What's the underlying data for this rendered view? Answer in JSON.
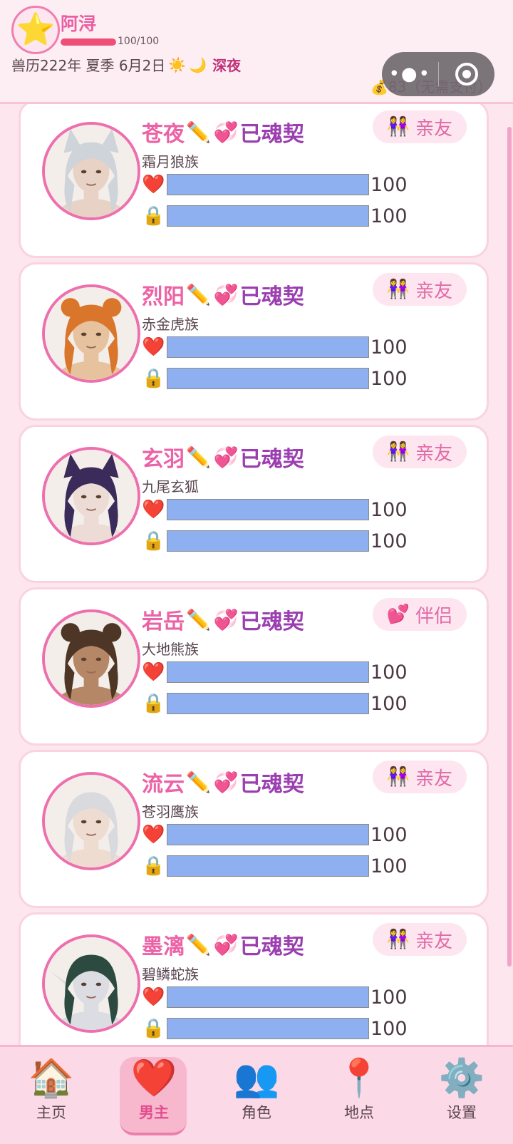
{
  "player": {
    "avatar_icon": "⭐",
    "name": "阿浔",
    "hp_current": 100,
    "hp_max": 100,
    "hp_text": "100/100",
    "date": "兽历222年 夏季 6月2日",
    "weather_icon": "☀️",
    "moon_icon": "🌙",
    "time_of_day": "深夜",
    "coins_text": "💰83（无需支付）"
  },
  "capsule": {
    "more_label": "•●•"
  },
  "characters": [
    {
      "name": "苍夜",
      "edit_icon": "✏️",
      "bond_icon": "💞",
      "status": "已魂契",
      "race": "霜月狼族",
      "tag_icon": "👭",
      "tag": "亲友",
      "affection": 100,
      "trust": 100,
      "affection_text": "100",
      "trust_text": "100",
      "hair": "#cfd3da",
      "skin": "#e8d2c6",
      "ears": "wolf"
    },
    {
      "name": "烈阳",
      "edit_icon": "✏️",
      "bond_icon": "💞",
      "status": "已魂契",
      "race": "赤金虎族",
      "tag_icon": "👭",
      "tag": "亲友",
      "affection": 100,
      "trust": 100,
      "affection_text": "100",
      "trust_text": "100",
      "hair": "#d9762b",
      "skin": "#e6c29e",
      "ears": "tiger"
    },
    {
      "name": "玄羽",
      "edit_icon": "✏️",
      "bond_icon": "💞",
      "status": "已魂契",
      "race": "九尾玄狐",
      "tag_icon": "👭",
      "tag": "亲友",
      "affection": 100,
      "trust": 100,
      "affection_text": "100",
      "trust_text": "100",
      "hair": "#3b2b5a",
      "skin": "#eddcd6",
      "ears": "fox"
    },
    {
      "name": "岩岳",
      "edit_icon": "✏️",
      "bond_icon": "💞",
      "status": "已魂契",
      "race": "大地熊族",
      "tag_icon": "💕",
      "tag": "伴侣",
      "affection": 100,
      "trust": 100,
      "affection_text": "100",
      "trust_text": "100",
      "hair": "#4e3626",
      "skin": "#b58766",
      "ears": "bear"
    },
    {
      "name": "流云",
      "edit_icon": "✏️",
      "bond_icon": "💞",
      "status": "已魂契",
      "race": "苍羽鹰族",
      "tag_icon": "👭",
      "tag": "亲友",
      "affection": 100,
      "trust": 100,
      "affection_text": "100",
      "trust_text": "100",
      "hair": "#d9dade",
      "skin": "#efdcd0",
      "ears": "none"
    },
    {
      "name": "墨漓",
      "edit_icon": "✏️",
      "bond_icon": "💞",
      "status": "已魂契",
      "race": "碧鳞蛇族",
      "tag_icon": "👭",
      "tag": "亲友",
      "affection": 100,
      "trust": 100,
      "affection_text": "100",
      "trust_text": "100",
      "hair": "#2d4a40",
      "skin": "#dcdde3",
      "ears": "elf"
    }
  ],
  "stat_icons": {
    "affection": "❤️",
    "trust": "🔒"
  },
  "nav": [
    {
      "icon": "🏠",
      "label": "主页",
      "active": false
    },
    {
      "icon": "❤️",
      "label": "男主",
      "active": true
    },
    {
      "icon": "👥",
      "label": "角色",
      "active": false
    },
    {
      "icon": "📍",
      "label": "地点",
      "active": false
    },
    {
      "icon": "⚙️",
      "label": "设置",
      "active": false
    }
  ],
  "colors": {
    "accent": "#ec62a6",
    "status": "#9b3fb0",
    "bar_fill": "#8fb0f0",
    "hp": "#ee4f79"
  }
}
